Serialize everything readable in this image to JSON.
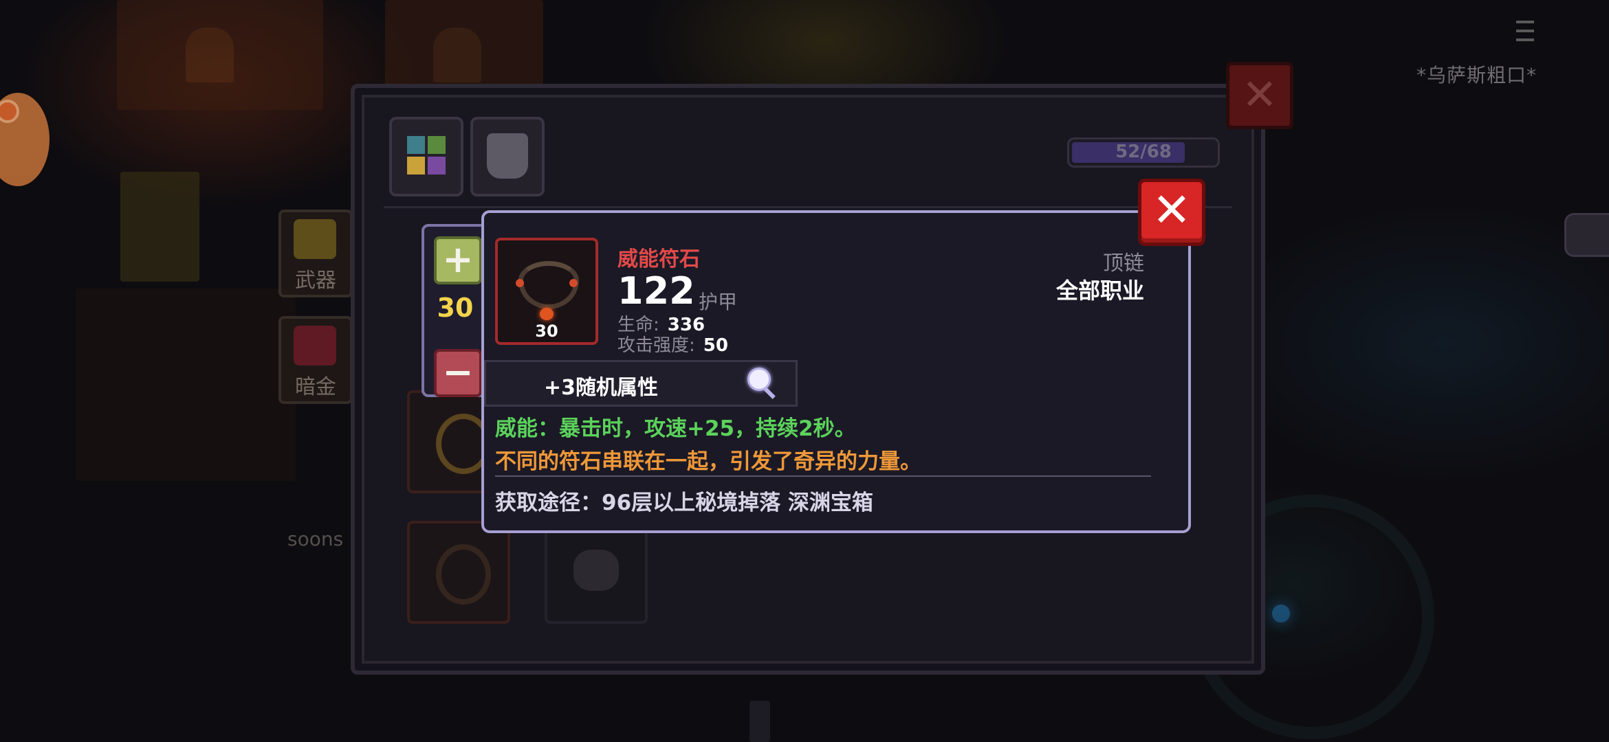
{
  "hud": {
    "player_name": "*乌萨斯粗口*",
    "controller_icon": "gamepad-icon",
    "menu_icon": "menu-icon"
  },
  "side_tabs": {
    "weapon_label": "武器",
    "dark_gold_label": "暗金",
    "other_player_label": "soons"
  },
  "inventory": {
    "capacity_text": "52/68",
    "capacity_fraction": 0.76,
    "tabs": [
      "bag-tab-icon",
      "armor-tab-icon"
    ],
    "close_icon": "close-icon"
  },
  "tooltip": {
    "level": "30",
    "plus_sign": "+",
    "minus_sign": "−",
    "item_level_badge": "30",
    "item_name": "威能符石",
    "armor_value": "122",
    "armor_label": "护甲",
    "stats": [
      {
        "label": "生命:",
        "value": "336"
      },
      {
        "label": "攻击强度:",
        "value": "50"
      }
    ],
    "slot_type": "顶链",
    "class_restriction": "全部职业",
    "random_attributes": "+3随机属性",
    "power_effect": "威能：暴击时，攻速+25，持续2秒。",
    "lore": "不同的符石串联在一起，引发了奇异的力量。",
    "source": "获取途径：96层以上秘境掉落 深渊宝箱",
    "close_glyph": "✕",
    "colors": {
      "name": "#e24a4a",
      "power": "#5bd35b",
      "lore": "#ef9838",
      "level": "#f3d34a",
      "close": "#d82525"
    }
  }
}
